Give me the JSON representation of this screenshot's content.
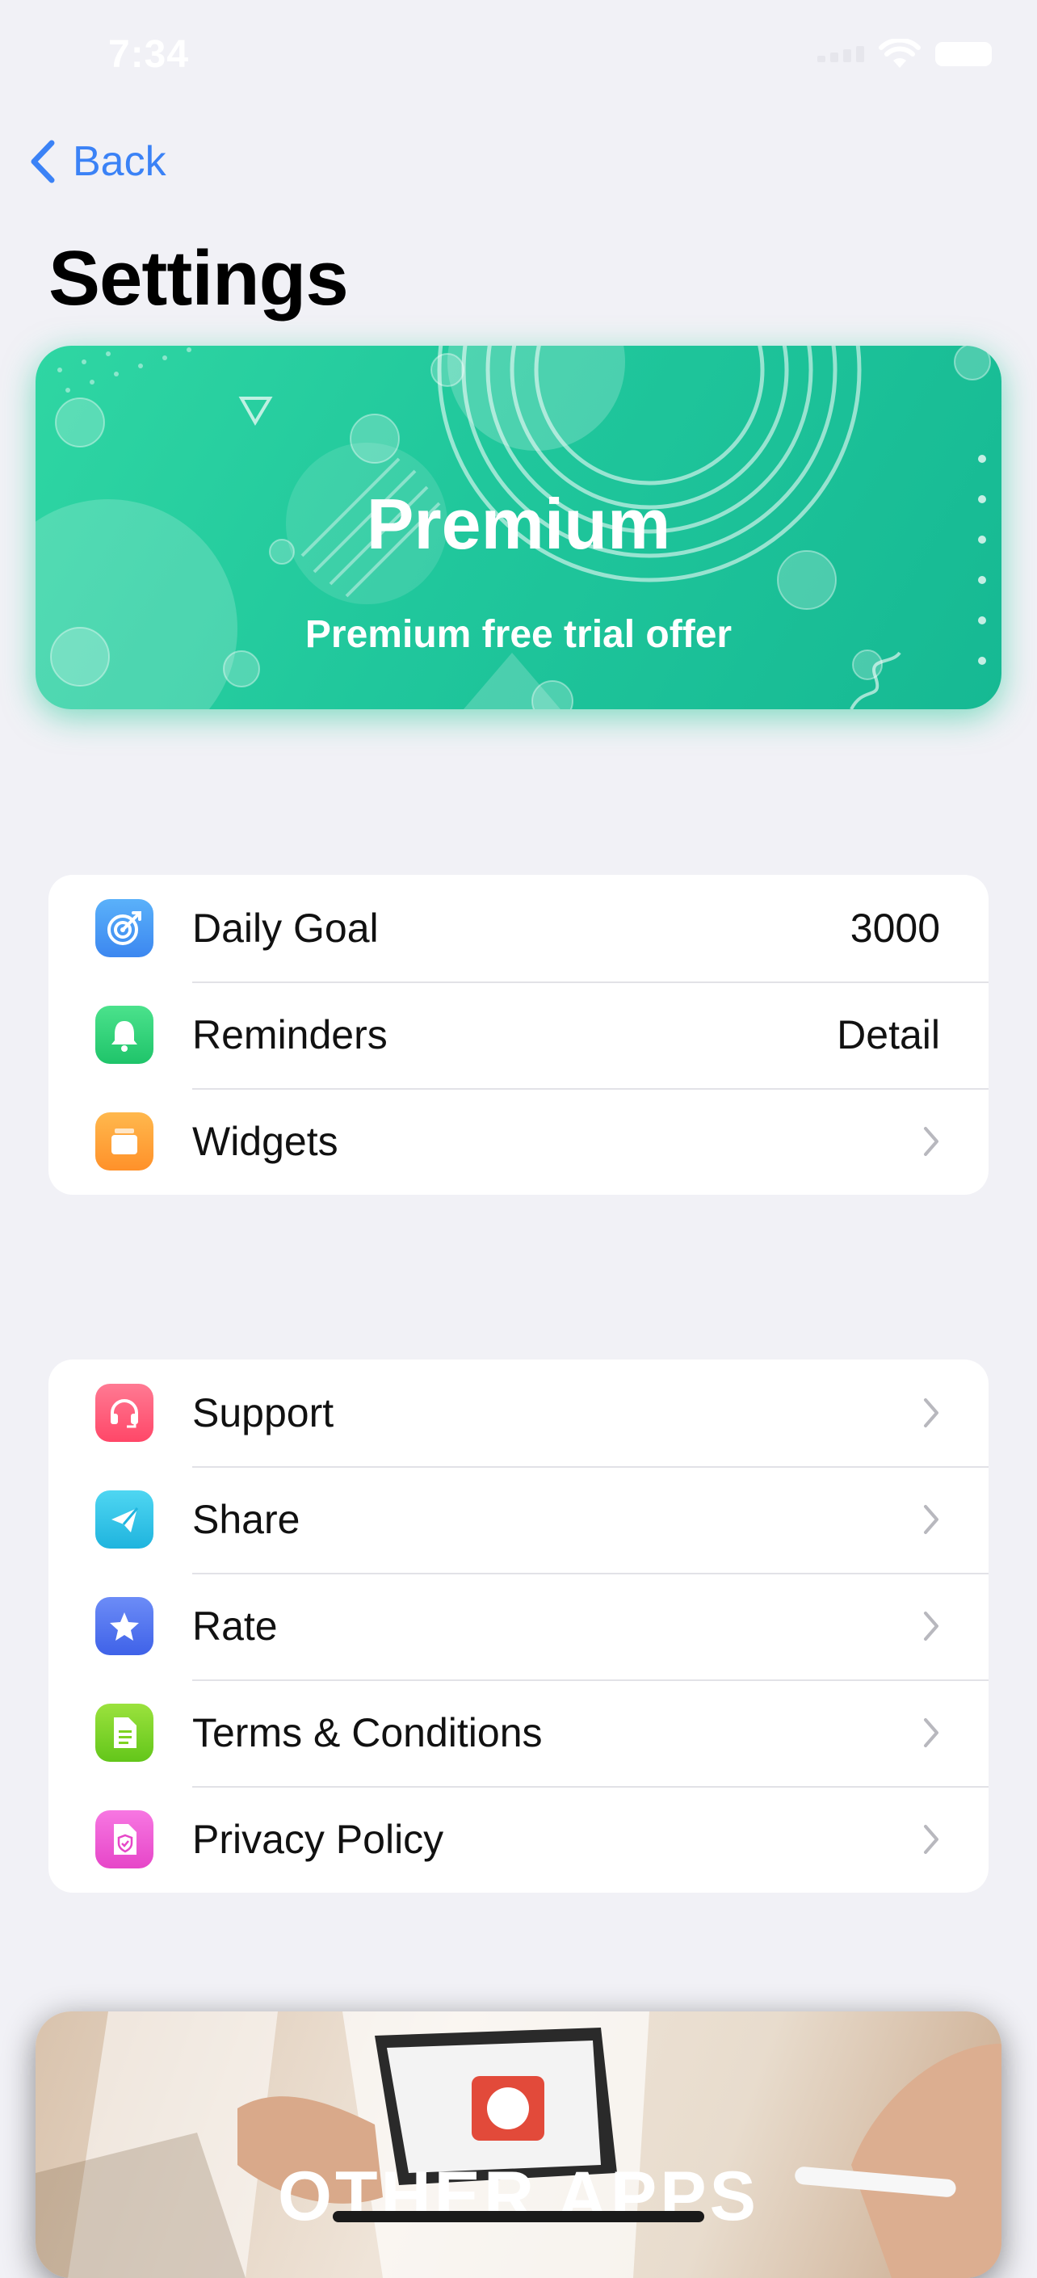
{
  "status_bar": {
    "time": "7:34"
  },
  "nav": {
    "back_label": "Back"
  },
  "page_title": "Settings",
  "premium": {
    "title": "Premium",
    "subtitle": "Premium free trial offer"
  },
  "group1": [
    {
      "label": "Daily Goal",
      "value": "3000",
      "icon": "target-icon",
      "color": "#4A9BF5"
    },
    {
      "label": "Reminders",
      "value": "Detail",
      "icon": "bell-icon",
      "color": "#2ED47A"
    },
    {
      "label": "Widgets",
      "value": "",
      "icon": "widgets-icon",
      "color": "#FFA23A"
    }
  ],
  "group2": [
    {
      "label": "Support",
      "icon": "headphones-icon",
      "color": "#FF5E7E"
    },
    {
      "label": "Share",
      "icon": "paper-plane-icon",
      "color": "#2FC6E8"
    },
    {
      "label": "Rate",
      "icon": "star-icon",
      "color": "#4F72EF"
    },
    {
      "label": "Terms & Conditions",
      "icon": "document-icon",
      "color": "#7ED321"
    },
    {
      "label": "Privacy Policy",
      "icon": "shield-document-icon",
      "color": "#F05FD6"
    }
  ],
  "other_apps": {
    "title": "OTHER APPS"
  },
  "colors": {
    "accent": "#3B82F6",
    "background": "#F1F1F6",
    "premium_green": "#20C79C"
  }
}
